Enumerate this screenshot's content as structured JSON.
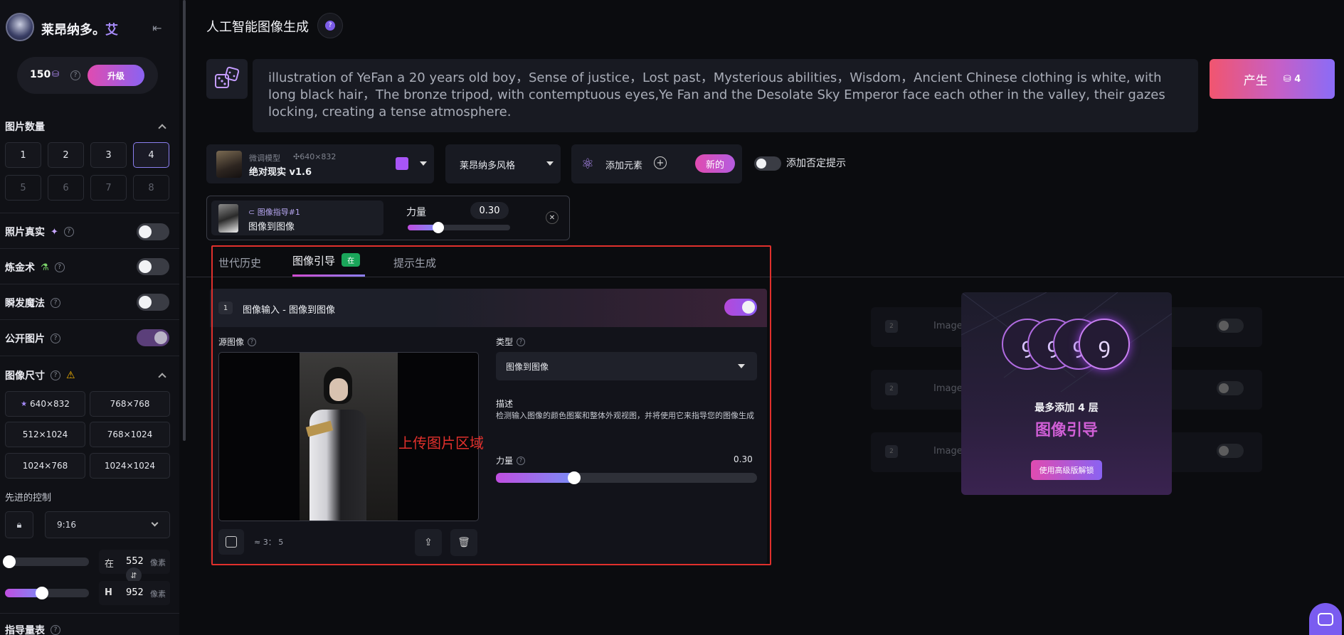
{
  "sidebar": {
    "brand": "莱昂纳多。",
    "brand_suffix": "艾",
    "credits": "150",
    "upgrade_label": "升级",
    "image_count": {
      "label": "图片数量",
      "options": [
        "1",
        "2",
        "3",
        "4",
        "5",
        "6",
        "7",
        "8"
      ],
      "selected": "4"
    },
    "photo_real_label": "照片真实",
    "alchemy_label": "炼金术",
    "prompt_magic_label": "瞬发魔法",
    "public_images_label": "公开图片",
    "image_size": {
      "label": "图像尺寸",
      "options": [
        "640×832",
        "768×768",
        "512×1024",
        "768×1024",
        "1024×768",
        "1024×1024"
      ],
      "selected": "640×832"
    },
    "advanced_label": "先进的控制",
    "aspect_ratio": "9:16",
    "width_prefix": "在",
    "width_value": "552",
    "height_prefix": "H",
    "height_value": "952",
    "unit": "像素",
    "guidance_label": "指导量表"
  },
  "header": {
    "title": "人工智能图像生成"
  },
  "prompt": {
    "text": "illustration of YeFan a 20 years old boy，Sense of justice，Lost past，Mysterious abilities，Wisdom，Ancient Chinese clothing is white, with long black hair，The bronze tripod, with contemptuous eyes,Ye Fan and the Desolate Sky Emperor face each other in the valley, their gazes locking, creating a tense atmosphere."
  },
  "generate": {
    "label": "产生",
    "cost": "4"
  },
  "model": {
    "tag": "微调模型",
    "dims": "640×832",
    "name": "绝对现实 v1.6"
  },
  "style_select": "莱昂纳多风格",
  "add_element": {
    "label": "添加元素",
    "badge": "新的"
  },
  "negative_prompt_label": "添加否定提示",
  "guidance_chip": {
    "tag": "图像指导#1",
    "name": "图像到图像",
    "strength_label": "力量",
    "strength_value": "0.30",
    "strength": 0.3
  },
  "tabs": {
    "history": "世代历史",
    "image_guidance": "图像引导",
    "image_guidance_badge": "在",
    "prompt_generation": "提示生成"
  },
  "image_input": {
    "index": "1",
    "title": "图像输入 - 图像到图像",
    "source_label": "源图像",
    "ratio": "≈ 3： 5",
    "type_label": "类型",
    "type_value": "图像到图像",
    "desc_label": "描述",
    "desc_text": "检测输入图像的颜色图案和整体外观视图，并将使用它来指导您的图像生成",
    "strength_label": "力量",
    "strength_value": "0.30",
    "strength": 0.3
  },
  "annotation_text": "上传图片区域",
  "locked_slots": {
    "slot_number": "2",
    "slot_label": "Image Inp"
  },
  "upsell": {
    "line1": "最多添加 4 层",
    "line2": "图像引导",
    "button": "使用高级版解锁"
  },
  "colors": {
    "accent_purple": "#8b5cf6",
    "accent_pink": "#e2469a",
    "generate_start": "#f1556f",
    "generate_end": "#8a6cf7",
    "annotation_red": "#e0302c",
    "tab_badge_green": "#1aa65a"
  }
}
